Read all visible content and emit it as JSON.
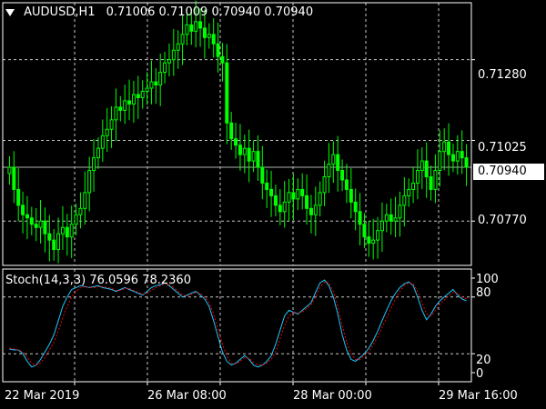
{
  "header": {
    "symbol": "AUDUSD,H1",
    "ohlc": "0.71006 0.71009 0.70940 0.70940"
  },
  "price_axis": {
    "labels": [
      "0.71280",
      "0.71025",
      "0.70770"
    ],
    "current": "0.70940"
  },
  "indicator": {
    "label": "Stoch(14,3,3) 76.0596 78.2360",
    "levels": [
      "100",
      "80",
      "20",
      "0"
    ]
  },
  "time_axis": {
    "labels": [
      "22 Mar 2019",
      "26 Mar 08:00",
      "28 Mar 00:00",
      "29 Mar 16:00"
    ]
  },
  "colors": {
    "bull": "#00ff00",
    "grid": "#c8c8c8",
    "main": "#1ec8ff",
    "signal": "#ff0000"
  },
  "chart_data": [
    {
      "type": "candlestick",
      "title": "AUDUSD,H1",
      "ylim": [
        0.7063,
        0.7146
      ],
      "y_ticks": [
        0.7128,
        0.71025,
        0.7077
      ],
      "current_price": 0.7094,
      "close": [
        0.7094,
        0.7087,
        0.7082,
        0.7079,
        0.7078,
        0.7076,
        0.7075,
        0.7077,
        0.7073,
        0.7071,
        0.7068,
        0.7073,
        0.7075,
        0.7072,
        0.7076,
        0.7079,
        0.7081,
        0.7086,
        0.7093,
        0.7097,
        0.71,
        0.7104,
        0.7106,
        0.7109,
        0.7113,
        0.7112,
        0.7115,
        0.7114,
        0.7117,
        0.7116,
        0.7118,
        0.7119,
        0.7121,
        0.712,
        0.7124,
        0.7127,
        0.7128,
        0.7131,
        0.7133,
        0.7136,
        0.7139,
        0.7137,
        0.714,
        0.7138,
        0.7135,
        0.7136,
        0.7133,
        0.7129,
        0.7127,
        0.7108,
        0.7103,
        0.7101,
        0.7098,
        0.71,
        0.7096,
        0.7099,
        0.7094,
        0.7089,
        0.7087,
        0.7085,
        0.7082,
        0.708,
        0.7083,
        0.7086,
        0.7084,
        0.7087,
        0.7085,
        0.7081,
        0.7079,
        0.7082,
        0.7086,
        0.7091,
        0.7095,
        0.7098,
        0.7093,
        0.709,
        0.7087,
        0.7083,
        0.708,
        0.7076,
        0.7072,
        0.707,
        0.7071,
        0.7074,
        0.7077,
        0.7079,
        0.7077,
        0.7078,
        0.7082,
        0.7085,
        0.7087,
        0.7089,
        0.7093,
        0.7096,
        0.7091,
        0.7087,
        0.7093,
        0.7099,
        0.7102,
        0.7098,
        0.7096,
        0.7099,
        0.7097,
        0.7094
      ],
      "time_labels": [
        "22 Mar 2019",
        "26 Mar 08:00",
        "28 Mar 00:00",
        "29 Mar 16:00"
      ]
    },
    {
      "type": "line",
      "title": "Stoch(14,3,3) 76.0596 78.2360",
      "ylim": [
        0,
        100
      ],
      "levels": [
        100,
        80,
        20,
        0
      ],
      "series": [
        {
          "name": "76.0596",
          "values": [
            25,
            24,
            24,
            20,
            12,
            6,
            8,
            14,
            22,
            30,
            40,
            55,
            70,
            80,
            88,
            90,
            92,
            91,
            90,
            91,
            92,
            90,
            89,
            88,
            86,
            88,
            90,
            88,
            86,
            84,
            82,
            86,
            90,
            92,
            93,
            95,
            92,
            88,
            84,
            80,
            82,
            84,
            86,
            82,
            78,
            70,
            55,
            38,
            22,
            12,
            8,
            10,
            14,
            18,
            14,
            8,
            6,
            8,
            12,
            18,
            30,
            45,
            60,
            66,
            64,
            62,
            66,
            70,
            74,
            85,
            95,
            98,
            92,
            80,
            62,
            40,
            24,
            14,
            12,
            16,
            20,
            26,
            34,
            44,
            55,
            66,
            76,
            84,
            90,
            94,
            96,
            92,
            80,
            66,
            56,
            62,
            70,
            76,
            80,
            84,
            88,
            82,
            78,
            76
          ]
        },
        {
          "name": "78.2360",
          "values": [
            26,
            25,
            24,
            22,
            16,
            10,
            8,
            10,
            16,
            24,
            32,
            44,
            58,
            70,
            80,
            86,
            90,
            91,
            90,
            90,
            91,
            91,
            90,
            89,
            87,
            87,
            89,
            89,
            87,
            85,
            83,
            84,
            87,
            90,
            92,
            94,
            93,
            90,
            86,
            82,
            81,
            83,
            85,
            84,
            80,
            74,
            62,
            46,
            30,
            18,
            10,
            9,
            12,
            16,
            15,
            11,
            8,
            8,
            10,
            14,
            22,
            36,
            50,
            60,
            64,
            63,
            64,
            68,
            72,
            80,
            90,
            96,
            95,
            86,
            70,
            50,
            32,
            20,
            14,
            14,
            18,
            22,
            30,
            38,
            48,
            58,
            68,
            78,
            86,
            92,
            95,
            94,
            86,
            74,
            62,
            60,
            66,
            72,
            77,
            81,
            85,
            84,
            80,
            78
          ]
        }
      ]
    }
  ]
}
